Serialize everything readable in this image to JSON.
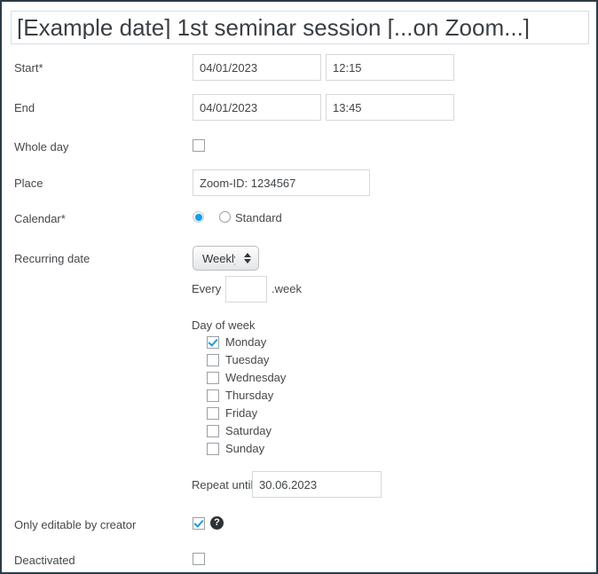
{
  "window": {
    "title_value": "[Example date] 1st seminar session [...on Zoom...]"
  },
  "form": {
    "start": {
      "label": "Start*",
      "date_value": "04/01/2023",
      "time_value": "12:15"
    },
    "end": {
      "label": "End",
      "date_value": "04/01/2023",
      "time_value": "13:45"
    },
    "whole_day": {
      "label": "Whole day",
      "checked": false
    },
    "place": {
      "label": "Place",
      "value": "Zoom-ID: 1234567"
    },
    "calendar": {
      "label": "Calendar*",
      "options": [
        {
          "label": "",
          "selected": true
        },
        {
          "label": "Standard",
          "selected": false
        }
      ]
    },
    "recurring": {
      "label": "Recurring date",
      "selected": "Weekly",
      "options": [
        "Weekly"
      ],
      "every_prefix": "Every",
      "every_value": "",
      "every_suffix": ".week",
      "day_of_week_label": "Day of week",
      "days": [
        {
          "label": "Monday",
          "checked": true
        },
        {
          "label": "Tuesday",
          "checked": false
        },
        {
          "label": "Wednesday",
          "checked": false
        },
        {
          "label": "Thursday",
          "checked": false
        },
        {
          "label": "Friday",
          "checked": false
        },
        {
          "label": "Saturday",
          "checked": false
        },
        {
          "label": "Sunday",
          "checked": false
        }
      ],
      "repeat_until_label": "Repeat until",
      "repeat_until_value": "30.06.2023"
    },
    "only_editable": {
      "label": "Only editable by creator",
      "checked": true,
      "help_icon": "question-mark-icon",
      "help_glyph": "?"
    },
    "deactivated": {
      "label": "Deactivated",
      "checked": false
    }
  },
  "colors": {
    "accent": "#1a9ae0",
    "radio_accent": "#0fa0e8",
    "page_border": "#2b3c46",
    "text": "#44484c",
    "input_border": "#d5d8da"
  }
}
